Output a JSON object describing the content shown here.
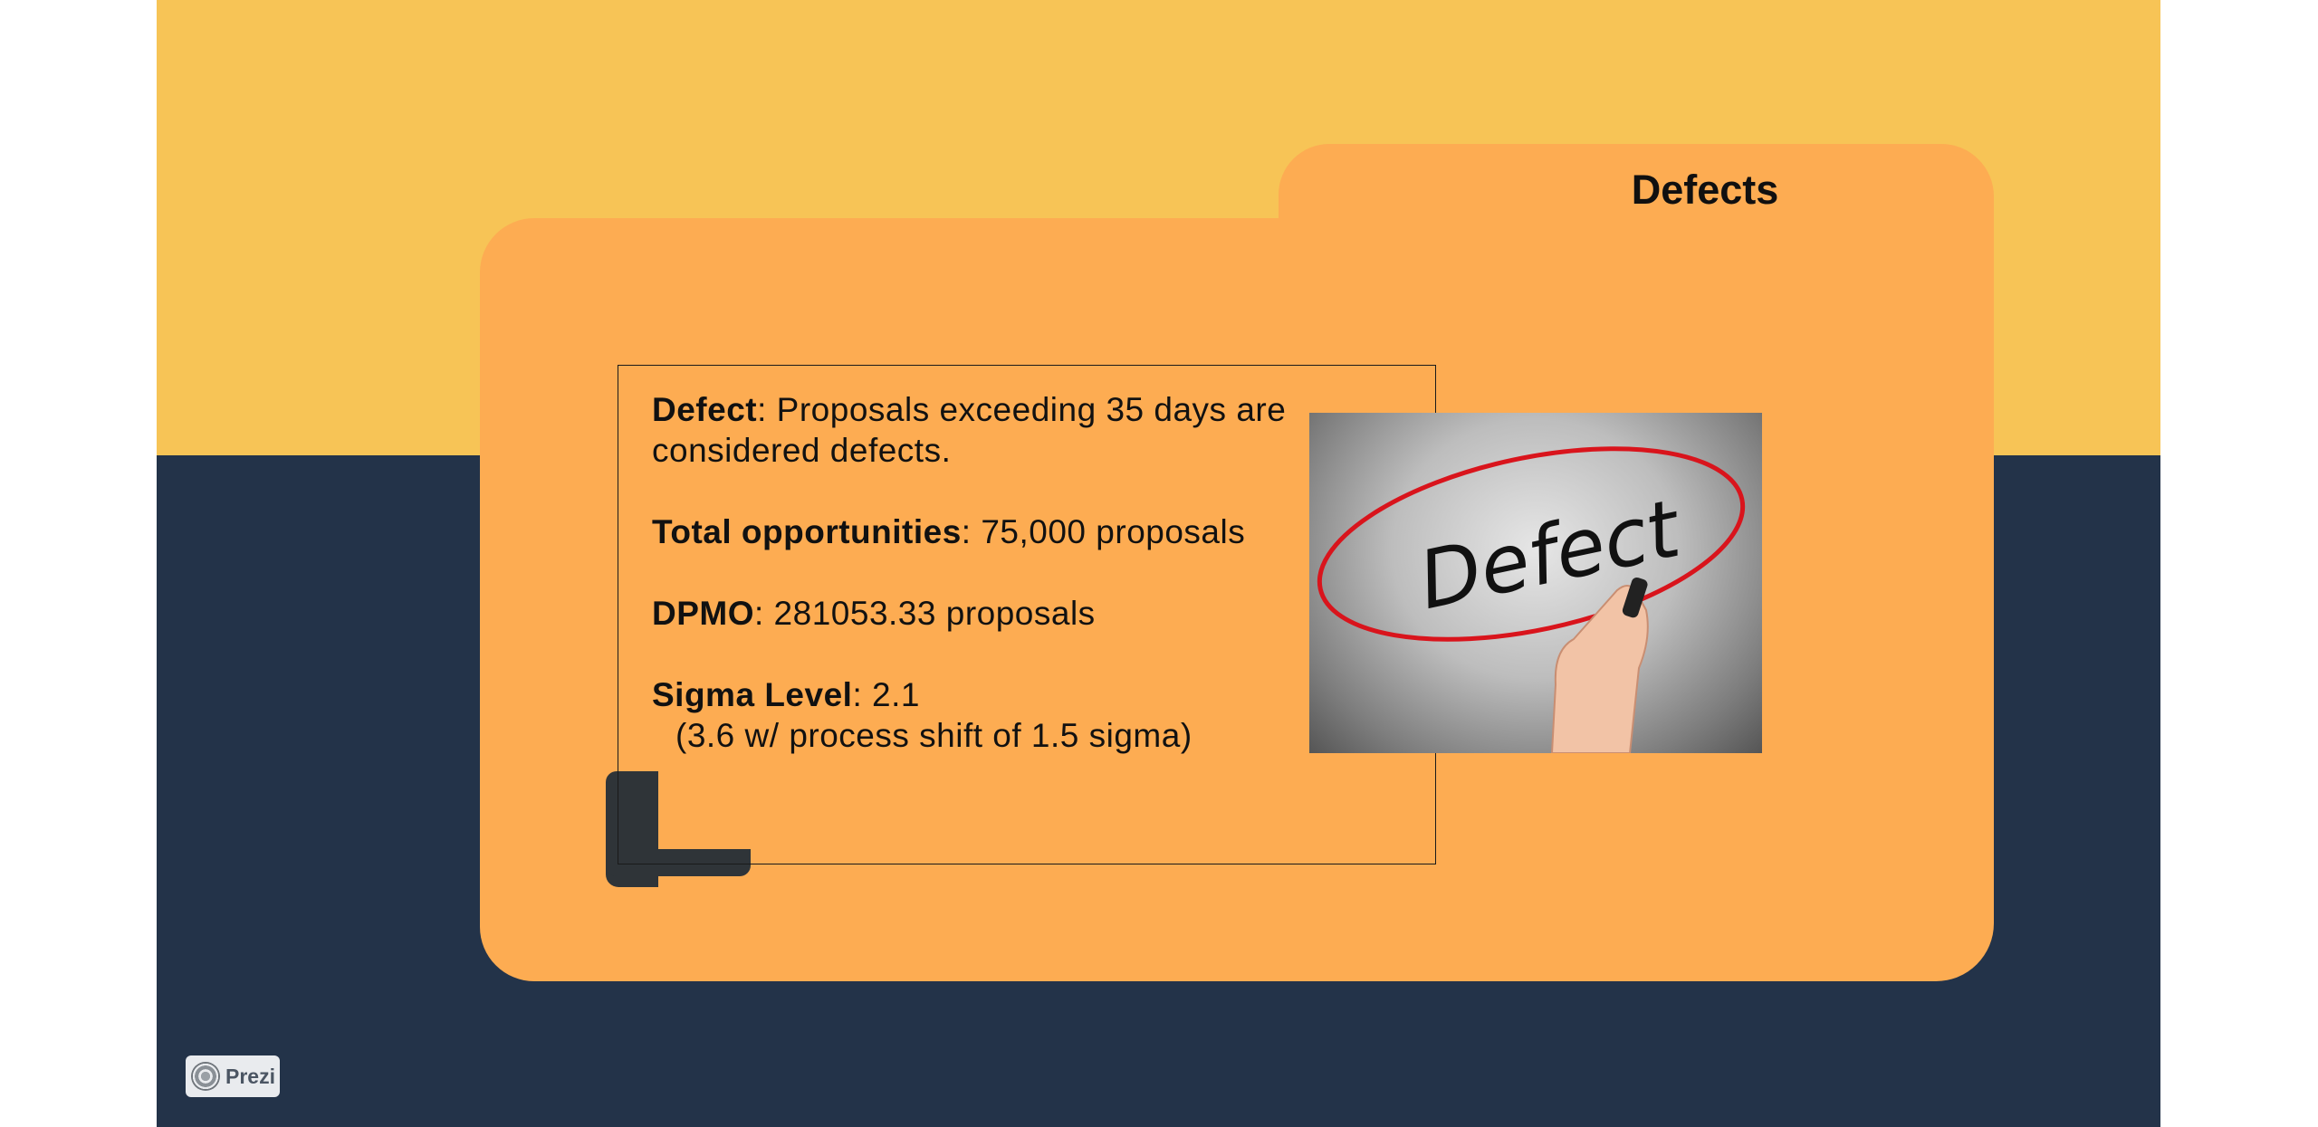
{
  "slide": {
    "title": "Defects",
    "content": {
      "defect_label": "Defect",
      "defect_text": ": Proposals exceeding 35 days are considered defects.",
      "opportunities_label": "Total opportunities",
      "opportunities_text": ": 75,000 proposals",
      "dpmo_label": "DPMO",
      "dpmo_text": ": 281053.33 proposals",
      "sigma_label": "Sigma Level",
      "sigma_text": ": 2.1",
      "sigma_note": "(3.6 w/ process shift of 1.5 sigma)"
    },
    "image_text": "Defect"
  },
  "branding": {
    "label": "Prezi",
    "icon": "prezi-logo-icon"
  },
  "colors": {
    "background_top": "#f7c456",
    "background_bottom": "#233349",
    "folder": "#fdac52",
    "ink_red": "#d9141c"
  }
}
